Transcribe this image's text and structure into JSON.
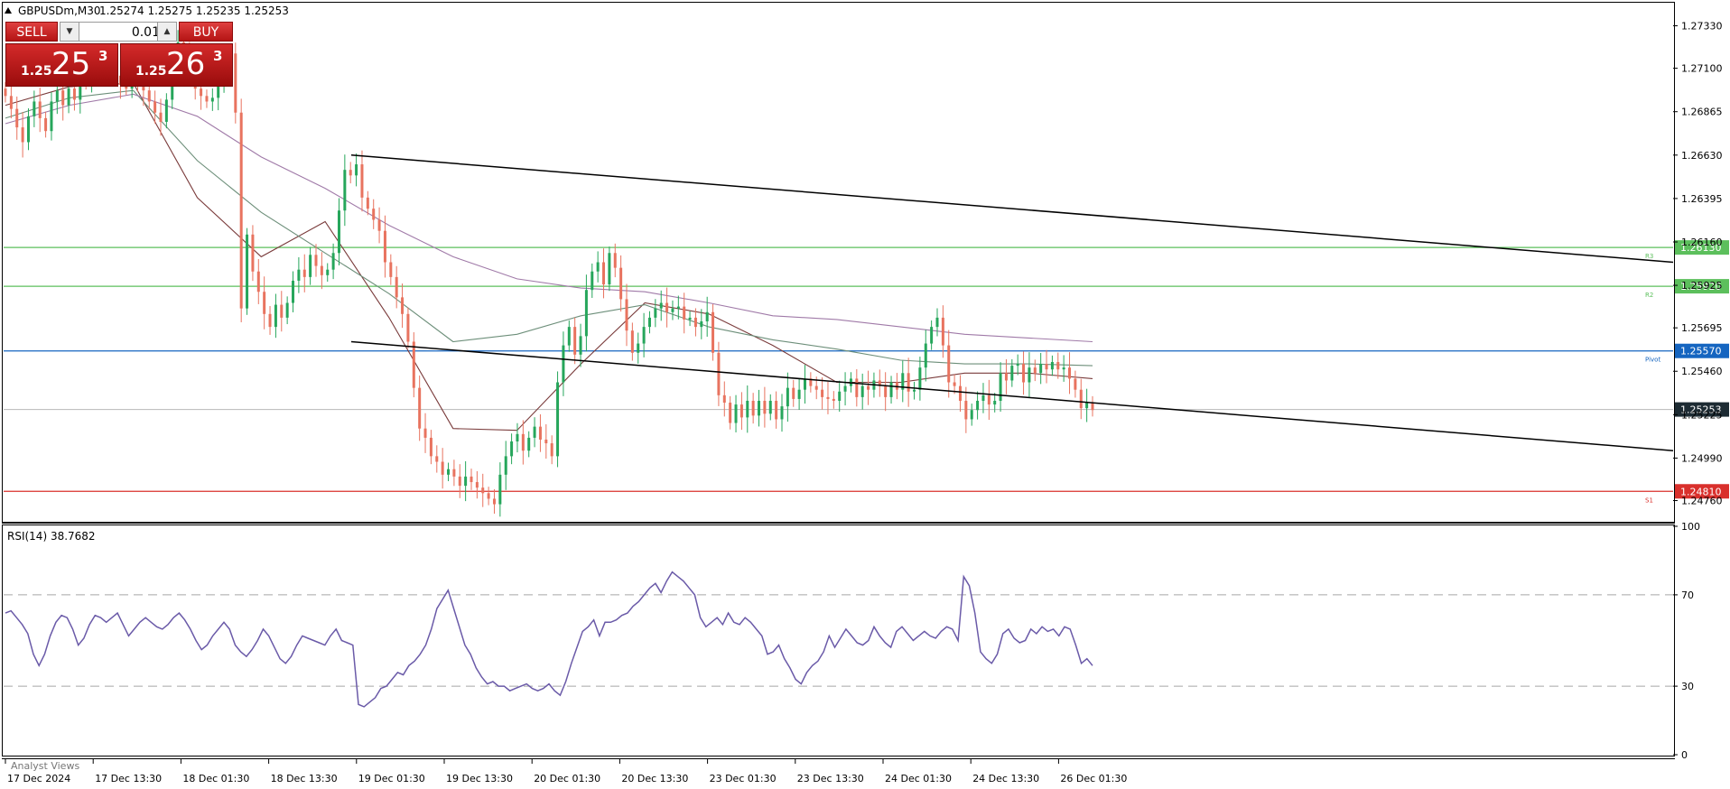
{
  "header": {
    "symbol": "GBPUSDm,M30",
    "ohlc": "1.25274 1.25275 1.25235 1.25253"
  },
  "trade": {
    "sell_label": "SELL",
    "buy_label": "BUY",
    "lot": "0.01",
    "sell_small": "1.25",
    "sell_big": "25",
    "sell_sup": "3",
    "buy_small": "1.25",
    "buy_big": "26",
    "buy_sup": "3"
  },
  "icons": {
    "collapse": "triangle-up-icon",
    "lot_down": "triangle-down-icon",
    "lot_up": "triangle-up-icon"
  },
  "colors": {
    "bull": "#26a65b",
    "bear": "#e8735f",
    "rsi": "#6a5aa8",
    "resistance": "#5cbf5c",
    "pivot": "#1565c0",
    "support": "#d9302c",
    "trendline": "#000000",
    "ma_fast": "#7a3b3b",
    "ma_mid": "#6d8f7a",
    "ma_slow": "#a07aa8"
  },
  "footer": {
    "analyst_views": "Analyst Views"
  },
  "chart_data": [
    {
      "type": "candlestick",
      "symbol": "GBPUSDm",
      "timeframe": "M30",
      "ylim": [
        1.2465,
        1.2745
      ],
      "price_ticks": [
        "1.27330",
        "1.27100",
        "1.26865",
        "1.26630",
        "1.26395",
        "1.26160",
        "1.25925",
        "1.25695",
        "1.25460",
        "1.25225",
        "1.24990",
        "1.24760"
      ],
      "x_ticks": [
        "17 Dec 2024",
        "17 Dec 13:30",
        "18 Dec 01:30",
        "18 Dec 13:30",
        "19 Dec 01:30",
        "19 Dec 13:30",
        "20 Dec 01:30",
        "20 Dec 13:30",
        "23 Dec 01:30",
        "23 Dec 13:30",
        "24 Dec 01:30",
        "24 Dec 13:30",
        "26 Dec 01:30"
      ],
      "current_price": "1.25253",
      "levels": [
        {
          "label": "R3",
          "price": "1.26130",
          "kind": "resistance"
        },
        {
          "label": "R2",
          "price": "1.25920",
          "kind": "resistance"
        },
        {
          "label": "Pivot",
          "price": "1.25570",
          "kind": "pivot"
        },
        {
          "label": "S1",
          "price": "1.24810",
          "kind": "support"
        }
      ],
      "trendlines": [
        {
          "name": "upper",
          "from": [
            0,
            1.2663
          ],
          "to": [
            1,
            1.2605
          ]
        },
        {
          "name": "lower",
          "from": [
            0,
            1.2562
          ],
          "to": [
            1,
            1.2503
          ]
        }
      ],
      "x_range": [
        0,
        1
      ],
      "closes": [
        1.2695,
        1.2688,
        1.2678,
        1.267,
        1.2684,
        1.2692,
        1.2683,
        1.2676,
        1.2692,
        1.2698,
        1.269,
        1.2699,
        1.2693,
        1.2705,
        1.2702,
        1.2708,
        1.271,
        1.2712,
        1.2708,
        1.2706,
        1.2701,
        1.2699,
        1.271,
        1.2704,
        1.2698,
        1.2692,
        1.2686,
        1.2681,
        1.2693,
        1.2716,
        1.2724,
        1.272,
        1.2708,
        1.2699,
        1.2695,
        1.2692,
        1.2694,
        1.2705,
        1.2712,
        1.2718,
        1.2686,
        1.258,
        1.262,
        1.26,
        1.2589,
        1.2577,
        1.257,
        1.2582,
        1.2575,
        1.2583,
        1.2595,
        1.2601,
        1.2597,
        1.2609,
        1.2603,
        1.2598,
        1.2601,
        1.261,
        1.2633,
        1.2655,
        1.2652,
        1.2658,
        1.264,
        1.2634,
        1.2628,
        1.2622,
        1.2605,
        1.2597,
        1.2586,
        1.2577,
        1.2562,
        1.2537,
        1.2515,
        1.251,
        1.25,
        1.2497,
        1.249,
        1.2493,
        1.2489,
        1.2484,
        1.2489,
        1.2486,
        1.2483,
        1.248,
        1.2477,
        1.2474,
        1.249,
        1.25,
        1.2508,
        1.2512,
        1.2503,
        1.251,
        1.2516,
        1.2509,
        1.2507,
        1.25,
        1.254,
        1.256,
        1.257,
        1.2555,
        1.2565,
        1.259,
        1.26,
        1.2605,
        1.2593,
        1.261,
        1.2602,
        1.2585,
        1.2568,
        1.2556,
        1.2561,
        1.257,
        1.2575,
        1.258,
        1.2583,
        1.2578,
        1.258,
        1.2581,
        1.2574,
        1.2575,
        1.257,
        1.2573,
        1.2578,
        1.2556,
        1.2533,
        1.2529,
        1.2518,
        1.2528,
        1.2521,
        1.253,
        1.2522,
        1.253,
        1.2523,
        1.253,
        1.252,
        1.2527,
        1.2537,
        1.2531,
        1.2536,
        1.2542,
        1.2538,
        1.2536,
        1.2532,
        1.2531,
        1.253,
        1.2535,
        1.2538,
        1.2542,
        1.2532,
        1.2538,
        1.2536,
        1.2541,
        1.2538,
        1.2532,
        1.254,
        1.2536,
        1.2545,
        1.2535,
        1.2536,
        1.2548,
        1.2561,
        1.257,
        1.2575,
        1.256,
        1.254,
        1.2538,
        1.253,
        1.252,
        1.2525,
        1.253,
        1.2533,
        1.2528,
        1.253,
        1.2545,
        1.2541,
        1.2549,
        1.255,
        1.254,
        1.2548,
        1.2545,
        1.255,
        1.2547,
        1.2551,
        1.2547,
        1.2548,
        1.2542,
        1.2536,
        1.2526,
        1.2529,
        1.2525
      ],
      "moving_averages": {
        "ma_fast": [
          1.269,
          1.27,
          1.2702,
          1.264,
          1.2608,
          1.2627,
          1.2575,
          1.2515,
          1.2514,
          1.255,
          1.2583,
          1.2577,
          1.256,
          1.254,
          1.254,
          1.2545,
          1.2545,
          1.2542
        ],
        "ma_mid": [
          1.2683,
          1.2694,
          1.2698,
          1.266,
          1.2632,
          1.261,
          1.2588,
          1.2562,
          1.2566,
          1.2576,
          1.2582,
          1.257,
          1.2563,
          1.2558,
          1.2552,
          1.255,
          1.255,
          1.2549
        ],
        "ma_slow": [
          1.268,
          1.269,
          1.2696,
          1.2684,
          1.2662,
          1.2645,
          1.2625,
          1.2608,
          1.2596,
          1.2591,
          1.2589,
          1.2583,
          1.2576,
          1.2574,
          1.257,
          1.2566,
          1.2564,
          1.2562
        ]
      }
    },
    {
      "type": "line",
      "title": "RSI(14) 38.7682",
      "ylim": [
        0,
        100
      ],
      "y_ticks": [
        "100",
        "70",
        "30",
        "0"
      ],
      "levels": [
        70,
        30
      ],
      "x_range": [
        0,
        1
      ],
      "values": [
        62,
        63,
        60,
        57,
        53,
        44,
        39,
        44,
        52,
        58,
        61,
        60,
        55,
        48,
        51,
        57,
        61,
        60,
        58,
        60,
        62,
        57,
        52,
        55,
        58,
        60,
        58,
        56,
        55,
        57,
        60,
        62,
        59,
        55,
        50,
        46,
        48,
        52,
        55,
        58,
        55,
        48,
        45,
        43,
        46,
        50,
        55,
        52,
        47,
        42,
        40,
        43,
        48,
        52,
        51,
        50,
        49,
        48,
        52,
        55,
        50,
        49,
        48,
        22,
        21,
        23,
        25,
        29,
        30,
        33,
        36,
        35,
        39,
        41,
        44,
        48,
        55,
        64,
        68,
        72,
        64,
        56,
        48,
        44,
        38,
        34,
        31,
        32,
        30,
        30,
        28,
        29,
        30,
        31,
        29,
        28,
        29,
        31,
        28,
        26,
        32,
        40,
        47,
        54,
        56,
        59,
        52,
        58,
        58,
        59,
        61,
        62,
        65,
        67,
        70,
        73,
        75,
        71,
        76,
        80,
        78,
        76,
        73,
        70,
        60,
        56,
        58,
        60,
        57,
        62,
        58,
        57,
        60,
        58,
        55,
        52,
        44,
        45,
        48,
        42,
        38,
        33,
        31,
        36,
        39,
        41,
        45,
        52,
        47,
        51,
        55,
        52,
        49,
        48,
        50,
        56,
        52,
        49,
        47,
        54,
        56,
        53,
        50,
        52,
        54,
        52,
        51,
        54,
        56,
        55,
        50,
        78,
        74,
        62,
        45,
        42,
        40,
        44,
        53,
        55,
        51,
        49,
        50,
        55,
        53,
        56,
        54,
        55,
        52,
        56,
        55,
        48,
        40,
        42,
        39
      ]
    }
  ]
}
